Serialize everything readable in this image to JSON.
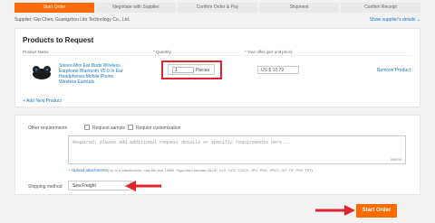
{
  "steps": [
    "Start Order",
    "Negotiate with Supplier",
    "Confirm Order & Pay",
    "Shipment",
    "Confirm Receipt"
  ],
  "supplier": {
    "text": "Supplier:  Gip Chen, Guangzhou Lito Technology Co., Ltd.",
    "details_link": "Show supplier's details ⌄"
  },
  "products": {
    "title": "Products to Request",
    "col_product": "Product Name",
    "col_quantity": "* Quantity",
    "col_price": "* Your offer (per unit price)",
    "item": {
      "name": "Stereo Mini Ear Buds Wireless Earphone Bluetooth V5.0 In Ear Headphones Mobile Phone Wireless Earbuds",
      "quantity": "1",
      "unit": "Pieces",
      "price": "US $  10.79",
      "remove": "Remove Product"
    },
    "add_new": "+ Add New Product"
  },
  "requirements": {
    "label": "Other requirements",
    "request_sample": "Request sample",
    "require_customization": "Require customization",
    "placeholder": "Required: please add additional request details or specific requirements here...",
    "char_count": "0/8000",
    "upload": "+ Upload attachments",
    "upload_hint": "(Up to 6 attachments, max file size 10MB. Supported formats: BLUE, XLS, DOC, DOCX, JPG, PNG, JPEG, GIF, TIF, PDF, TXT)",
    "shipping_label": "Shipping method",
    "shipping_value": "Sea Freight"
  },
  "start_order_button": "Start Order",
  "colors": {
    "accent": "#ff6a00",
    "highlight": "#e0242e",
    "link": "#1a78c2"
  }
}
